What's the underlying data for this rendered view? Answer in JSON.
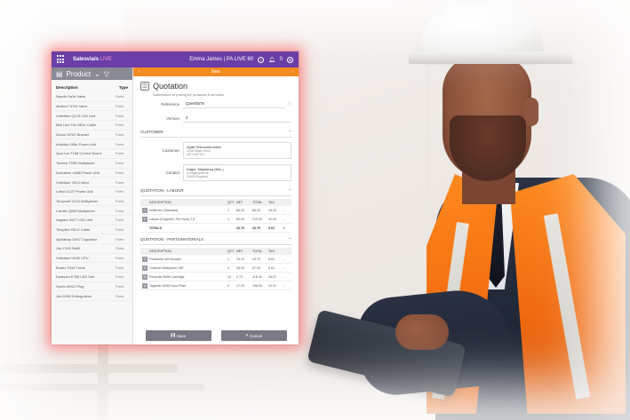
{
  "app": {
    "brand": "Salesvials",
    "brand_tag": "LIVE",
    "user": "Emma James | PA LIVE 60",
    "notification_count": "0"
  },
  "left_pane": {
    "header": "Product",
    "col_description": "Description",
    "col_type": "Type",
    "rows": [
      {
        "desc": "Namfix 9a1e Valve",
        "type": "Parts"
      },
      {
        "desc": "Aerflex7 6761 Valve",
        "type": "Parts"
      },
      {
        "desc": "Volteliam Q123 LED Unit",
        "type": "Parts"
      },
      {
        "desc": "Mat Lam Tier A81e Cable",
        "type": "Parts"
      },
      {
        "desc": "Dlcom M702 Bracket",
        "type": "Parts"
      },
      {
        "desc": "Ambdia G58e Power Unit",
        "type": "Parts"
      },
      {
        "desc": "Qua Lux T168 Control Board",
        "type": "Parts"
      },
      {
        "desc": "Tonbiur T258 Multiplexer",
        "type": "Parts"
      },
      {
        "desc": "Domainer U886 Power Unit",
        "type": "Parts"
      },
      {
        "desc": "Volteliam X514 Valve",
        "type": "Parts"
      },
      {
        "desc": "Lottur D137 Power Unit",
        "type": "Parts"
      },
      {
        "desc": "Tempsoft V218 Multiplexer",
        "type": "Parts"
      },
      {
        "desc": "Cardfix Q898 Multiplexer",
        "type": "Parts"
      },
      {
        "desc": "Vagram X677 LED Unit",
        "type": "Parts"
      },
      {
        "desc": "Tempflex R512 Cable",
        "type": "Parts"
      },
      {
        "desc": "Alphatrap U947 Capacitor",
        "type": "Parts"
      },
      {
        "desc": "Job Y163 Refill",
        "type": "Parts"
      },
      {
        "desc": "Volteliam U626 CPU",
        "type": "Parts"
      },
      {
        "desc": "Bodex T616 Trunk",
        "type": "Parts"
      },
      {
        "desc": "Dualsam E765 LED Unit",
        "type": "Parts"
      },
      {
        "desc": "Opelo W912 Plug",
        "type": "Parts"
      },
      {
        "desc": "Job D592 Extinguisher",
        "type": "Parts"
      }
    ]
  },
  "right_pane": {
    "subbar_title": "New",
    "title": "Quotation",
    "subtitle": "Submission of pricing for products & services.",
    "reference_label": "Reference",
    "reference_value": "Q3e00576",
    "version_label": "Version",
    "version_value": "2",
    "customer_section": "CUSTOMER",
    "customer_label": "Customer",
    "customer_name": "Hyatt Telecoms/cation",
    "customer_addr1": "1238 Major Drive",
    "customer_addr2": "UB 1069 617",
    "contact_label": "Contact",
    "contact_name": "Eagle, Madalena (Mrs.)",
    "contact_email": "m.eagle@htt.uk",
    "contact_addr": "26420 England",
    "labour_section": "QUOTATION - LABOUR",
    "parts_section": "QUOTATION - PARTS/MATERIALS",
    "cols": {
      "desc": "DESCRIPTION",
      "qty": "QTY",
      "net": "NET",
      "total": "TOTAL",
      "tax": "TAX"
    },
    "labour_rows": [
      {
        "n": "1",
        "desc": "Initial fee (Standard)",
        "qty": "1",
        "net": "80.00",
        "total": "80.00",
        "tax": "18.00"
      },
      {
        "n": "2",
        "desc": "Labour (Engineer, Per Hour) 2.5",
        "qty": "1",
        "net": "80.00",
        "total": "210.00",
        "tax": "42.00"
      }
    ],
    "labour_totals": {
      "label": "TOTALS",
      "net": "22.70",
      "total": "22.70",
      "tax": "3.61"
    },
    "parts_rows": [
      {
        "n": "1",
        "desc": "Flowsheet still Booster",
        "qty": "1",
        "net": "25.10",
        "total": "43.70",
        "tax": "5.61"
      },
      {
        "n": "2",
        "desc": "Channel Multiplexer 987",
        "qty": "2",
        "net": "33.00",
        "total": "87.00",
        "tax": "5.61"
      },
      {
        "n": "3",
        "desc": "Recorder Refill Cartridge",
        "qty": "10",
        "net": "2.73",
        "total": "118.20",
        "tax": "26.07"
      },
      {
        "n": "4",
        "desc": "Tagester D050 Door Plate",
        "qty": "9",
        "net": "17.43",
        "total": "158.00",
        "tax": "24.51"
      }
    ],
    "save_label": "Save",
    "cancel_label": "Cancel"
  }
}
